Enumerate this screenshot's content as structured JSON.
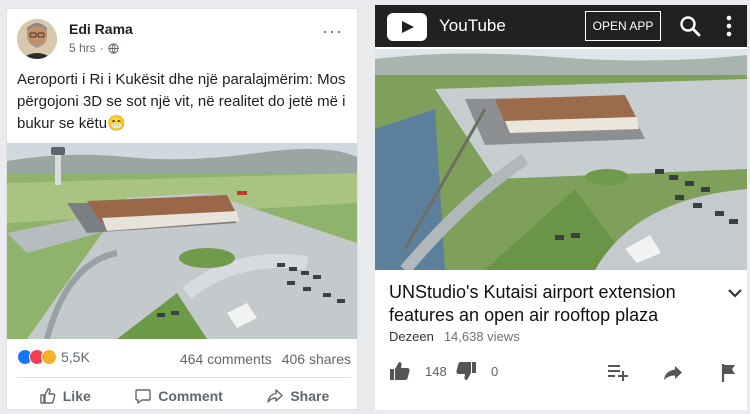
{
  "facebook": {
    "author": "Edi Rama",
    "time": "5 hrs",
    "privacy_icon": "globe-icon",
    "more_label": "···",
    "text": "Aeroporti i Ri i Kukësit dhe një paralajmërim: Mos përgojoni 3D se sot një vit, në realitet do jetë më i bukur se këtu😁",
    "reactions": {
      "count": "5,5K",
      "types": [
        "like",
        "love",
        "haha"
      ]
    },
    "comments": "464 comments",
    "shares": "406 shares",
    "actions": {
      "like": "Like",
      "comment": "Comment",
      "share": "Share"
    }
  },
  "youtube": {
    "app_name": "YouTube",
    "open_app": "OPEN APP",
    "video_title": "UNStudio's Kutaisi airport extension features an open air rooftop plaza",
    "channel": "Dezeen",
    "views": "14,638 views",
    "likes": "148",
    "dislikes": "0"
  },
  "colors": {
    "fb_blue": "#1877f2",
    "love": "#f33e58",
    "haha": "#f7b125",
    "yt_bar": "#212121"
  }
}
